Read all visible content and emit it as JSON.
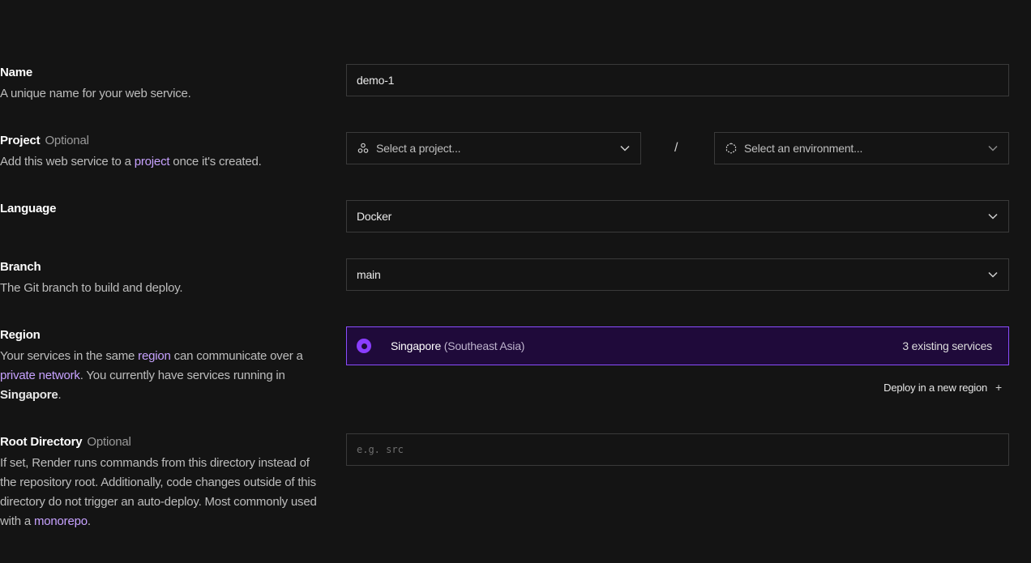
{
  "name": {
    "title": "Name",
    "description": "A unique name for your web service.",
    "value": "demo-1"
  },
  "project": {
    "title": "Project",
    "optional": "Optional",
    "desc_before": "Add this web service to a ",
    "desc_link": "project",
    "desc_after": " once it's created.",
    "project_placeholder": "Select a project...",
    "separator": "/",
    "environment_placeholder": "Select an environment..."
  },
  "language": {
    "title": "Language",
    "value": "Docker"
  },
  "branch": {
    "title": "Branch",
    "description": "The Git branch to build and deploy.",
    "value": "main"
  },
  "region": {
    "title": "Region",
    "desc_1": "Your services in the same ",
    "desc_link_1": "region",
    "desc_2": " can communicate over a ",
    "desc_link_2": "private network",
    "desc_3": ". You currently have services running in ",
    "desc_bold": "Singapore",
    "desc_4": ".",
    "selected_name": "Singapore",
    "selected_sub": "(Southeast Asia)",
    "selected_count": "3 existing services",
    "deploy_new_label": "Deploy in a new region",
    "deploy_new_icon": "+",
    "accent_color": "#8a3dff"
  },
  "root_directory": {
    "title": "Root Directory",
    "optional": "Optional",
    "desc_before": "If set, Render runs commands from this directory instead of the repository root. Additionally, code changes outside of this directory do not trigger an auto-deploy. Most commonly used with a ",
    "desc_link": "monorepo",
    "desc_after": ".",
    "placeholder": "e.g. src"
  }
}
